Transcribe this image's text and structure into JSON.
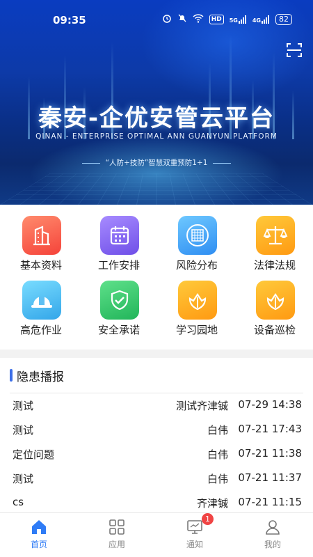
{
  "status_bar": {
    "time": "09:35",
    "hd_label": "HD",
    "net1": "5G",
    "net2": "4G",
    "battery": "82"
  },
  "hero": {
    "title": "秦安-企优安管云平台",
    "subtitle": "QINAN - ENTERPRISE OPTIMAL ANN GUANYUN PLATFORM",
    "slogan": "“人防+技防”智慧双重预防1+1",
    "scan_icon": "scan-icon"
  },
  "menu": {
    "items": [
      {
        "label": "基本资料",
        "icon": "building-icon",
        "color": "#f5433a"
      },
      {
        "label": "工作安排",
        "icon": "calendar-icon",
        "color": "#6f4fe8"
      },
      {
        "label": "风险分布",
        "icon": "grid-globe-icon",
        "color": "#2f8ef2"
      },
      {
        "label": "法律法规",
        "icon": "scales-icon",
        "color": "#ff9a12"
      },
      {
        "label": "高危作业",
        "icon": "helmet-icon",
        "color": "#33a6e9"
      },
      {
        "label": "安全承诺",
        "icon": "shield-check-icon",
        "color": "#22b55a"
      },
      {
        "label": "学习园地",
        "icon": "flower-shield-icon",
        "color": "#ff9a12"
      },
      {
        "label": "设备巡检",
        "icon": "flower-shield-icon",
        "color": "#ff9a12"
      }
    ]
  },
  "news": {
    "title": "隐患播报",
    "rows": [
      {
        "title": "测试",
        "person": "测试齐津铖",
        "time": "07-29 14:38"
      },
      {
        "title": "测试",
        "person": "白伟",
        "time": "07-21 17:43"
      },
      {
        "title": "定位问题",
        "person": "白伟",
        "time": "07-21 11:38"
      },
      {
        "title": "测试",
        "person": "白伟",
        "time": "07-21 11:37"
      },
      {
        "title": "cs",
        "person": "齐津铖",
        "time": "07-21 11:15"
      }
    ]
  },
  "tabs": [
    {
      "label": "首页",
      "icon": "home-icon",
      "active": true
    },
    {
      "label": "应用",
      "icon": "apps-grid-icon",
      "active": false
    },
    {
      "label": "通知",
      "icon": "monitor-icon",
      "active": false,
      "badge": "1"
    },
    {
      "label": "我的",
      "icon": "user-icon",
      "active": false
    }
  ],
  "colors": {
    "accent": "#2f7cf6",
    "badge": "#f04444",
    "hero_dark": "#0b2a6e"
  }
}
